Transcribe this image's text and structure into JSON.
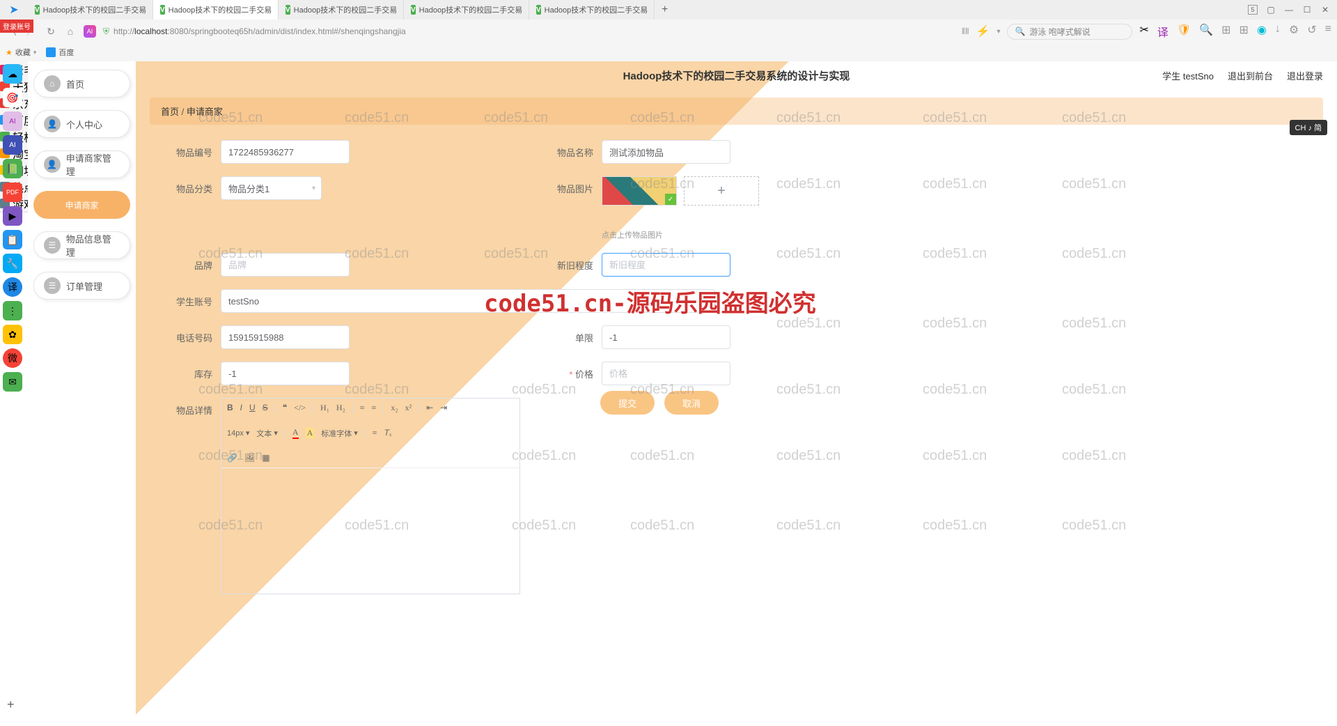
{
  "browser": {
    "tabs": [
      "Hadoop技术下的校园二手交易",
      "Hadoop技术下的校园二手交易",
      "Hadoop技术下的校园二手交易",
      "Hadoop技术下的校园二手交易",
      "Hadoop技术下的校园二手交易"
    ],
    "tab_count_badge": "5",
    "url_prefix": "http://",
    "url_host": "localhost",
    "url_rest": ":8080/springbooteq65h/admin/dist/index.html#/shenqingshangjia",
    "search_placeholder": "游泳 咆哮式解说"
  },
  "bookmarks": {
    "fav": "收藏",
    "items": [
      "百度",
      "老毛桃官网",
      "天猫购物",
      "京东购物",
      "百度搜索",
      "轻松办公",
      "淘宝",
      "网址导航",
      "热点新闻",
      "游戏娱乐"
    ]
  },
  "dock": [
    "☁",
    "🎯",
    "AI",
    "AI",
    "📕",
    "📄",
    "▶",
    "📋",
    "🔧",
    "🔵",
    "⋮",
    "🟢",
    "🔴",
    "✉"
  ],
  "header": {
    "title": "Hadoop技术下的校园二手交易系统的设计与实现",
    "user": "学生 testSno",
    "logout_front": "退出到前台",
    "logout": "退出登录"
  },
  "sidebar": {
    "home": "首页",
    "profile": "个人中心",
    "merchant": "申请商家管理",
    "merchant_apply": "申请商家",
    "product": "物品信息管理",
    "order": "订单管理"
  },
  "breadcrumb": {
    "home": "首页",
    "current": "申请商家"
  },
  "form": {
    "product_id_label": "物品编号",
    "product_id_value": "1722485936277",
    "product_name_label": "物品名称",
    "product_name_value": "测试添加物品",
    "category_label": "物品分类",
    "category_value": "物品分类1",
    "image_label": "物品图片",
    "upload_hint": "点击上传物品图片",
    "brand_label": "品牌",
    "brand_placeholder": "品牌",
    "condition_label": "新旧程度",
    "condition_placeholder": "新旧程度",
    "account_label": "学生账号",
    "account_value": "testSno",
    "phone_label": "电话号码",
    "phone_value": "15915915988",
    "limit_label": "单限",
    "limit_value": "-1",
    "stock_label": "库存",
    "stock_value": "-1",
    "price_label": "价格",
    "price_placeholder": "价格",
    "detail_label": "物品详情",
    "submit": "提交",
    "cancel": "取消"
  },
  "editor": {
    "fontsize": "14px",
    "style": "文本",
    "font": "标准字体"
  },
  "watermark_text": "code51.cn",
  "watermark_big": "code51.cn-源码乐园盗图必究",
  "ime": "CH ♪ 简",
  "login_badge": "登录账号"
}
